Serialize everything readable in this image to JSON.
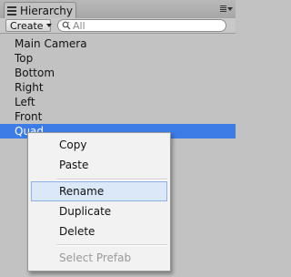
{
  "window": {
    "tab_title": "Hierarchy",
    "tab_icon": "hierarchy-list-icon",
    "menu_icon": "panel-menu-icon"
  },
  "toolbar": {
    "create_label": "Create",
    "search_placeholder": "All"
  },
  "hierarchy": {
    "items": [
      {
        "label": "Main Camera"
      },
      {
        "label": "Top"
      },
      {
        "label": "Bottom"
      },
      {
        "label": "Right"
      },
      {
        "label": "Left"
      },
      {
        "label": "Front"
      },
      {
        "label": "Quad",
        "selected": true
      }
    ]
  },
  "context_menu": {
    "items": [
      {
        "label": "Copy"
      },
      {
        "label": "Paste"
      },
      {
        "label": "Rename",
        "highlighted": true
      },
      {
        "label": "Duplicate"
      },
      {
        "label": "Delete"
      },
      {
        "label": "Select Prefab",
        "disabled": true
      }
    ]
  },
  "colors": {
    "selection": "#3d7ce6",
    "panel_bg": "#c2c2c2",
    "menu_bg": "#f2f2f2",
    "menu_highlight": "#dbe8f8"
  }
}
